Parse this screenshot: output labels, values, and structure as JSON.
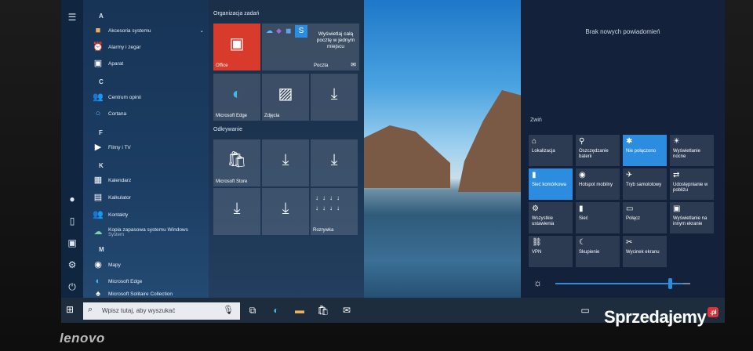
{
  "start": {
    "letters": [
      "A",
      "C",
      "F",
      "K",
      "M"
    ],
    "apps": [
      {
        "icon": "folder-icon",
        "label": "Akcesoria systemu",
        "expand": "⌄"
      },
      {
        "icon": "alarm-clock-icon",
        "label": "Alarmy i zegar"
      },
      {
        "icon": "camera-icon",
        "label": "Aparat"
      },
      {
        "icon": "feedback-hub-icon",
        "label": "Centrum opinii"
      },
      {
        "icon": "cortana-icon",
        "label": "Cortana"
      },
      {
        "icon": "films-tv-icon",
        "label": "Filmy i TV"
      },
      {
        "icon": "calendar-icon",
        "label": "Kalendarz"
      },
      {
        "icon": "calculator-icon",
        "label": "Kalkulator"
      },
      {
        "icon": "contacts-icon",
        "label": "Kontakty"
      },
      {
        "icon": "backup-icon",
        "label": "Kopia zapasowa systemu Windows",
        "sub": "System"
      },
      {
        "icon": "maps-icon",
        "label": "Mapy"
      },
      {
        "icon": "edge-icon",
        "label": "Microsoft Edge"
      },
      {
        "icon": "solitaire-icon",
        "label": "Microsoft Solitaire Collection"
      }
    ],
    "groups": [
      "Organizacja zadań",
      "Odkrywanie"
    ],
    "tiles": {
      "office": "Office",
      "mail_text": "Wyświetlaj całą pocztę w jednym miejscu",
      "mail": "Poczta",
      "edge": "Microsoft Edge",
      "photos": "Zdjęcia",
      "store": "Microsoft Store",
      "games": "Rozrywka"
    }
  },
  "taskbar": {
    "search_placeholder": "Wpisz tutaj, aby wyszukać"
  },
  "action_center": {
    "no_notifications": "Brak nowych powiadomień",
    "collapse": "Zwiń",
    "actions": [
      {
        "icon": "location-icon",
        "label": "Lokalizacja",
        "on": false
      },
      {
        "icon": "battery-saver-icon",
        "label": "Oszczędzanie baterii",
        "on": false
      },
      {
        "icon": "bluetooth-icon",
        "label": "Nie połączono",
        "on": true
      },
      {
        "icon": "night-light-icon",
        "label": "Wyświetlanie nocne",
        "on": false
      },
      {
        "icon": "network-icon",
        "label": "Sieć komórkowa",
        "on": true
      },
      {
        "icon": "hotspot-icon",
        "label": "Hotspot mobilny",
        "on": false
      },
      {
        "icon": "airplane-icon",
        "label": "Tryb samolotowy",
        "on": false
      },
      {
        "icon": "nearby-share-icon",
        "label": "Udostępnianie w pobliżu",
        "on": false
      },
      {
        "icon": "settings-icon",
        "label": "Wszystkie ustawienia",
        "on": false
      },
      {
        "icon": "network-icon",
        "label": "Sieć",
        "on": false
      },
      {
        "icon": "connect-icon",
        "label": "Połącz",
        "on": false
      },
      {
        "icon": "project-icon",
        "label": "Wyświetlanie na innym ekranie",
        "on": false
      },
      {
        "icon": "vpn-icon",
        "label": "VPN",
        "on": false
      },
      {
        "icon": "focus-assist-icon",
        "label": "Skupienie",
        "on": false
      },
      {
        "icon": "screen-snip-icon",
        "label": "Wycinek ekranu",
        "on": false
      }
    ],
    "brightness": 0.9
  },
  "bezel": {
    "brand": "lenovo"
  },
  "watermark": {
    "text": "Sprzedajemy",
    "suffix": ".pl"
  },
  "colors": {
    "accent": "#2b8ce0",
    "office": "#d83b2b"
  }
}
